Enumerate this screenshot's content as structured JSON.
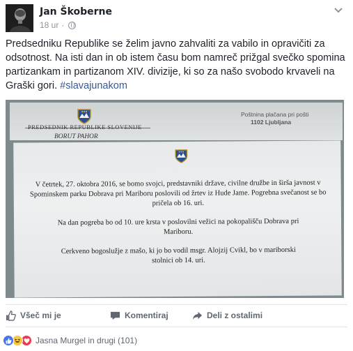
{
  "post": {
    "author": "Jan Škoberne",
    "timestamp": "18 ur",
    "separator": "·",
    "audience_icon": "globe-icon",
    "text_main": "Predsedniku Republike se želim javno zahvaliti za vabilo in opravičiti za odsotnost. Na isti dan in ob istem času bom namreč prižgal svečko spomina partizankam in partizanom XIV. divizije, ki so za našo svobodo krvaveli na Graški gori. ",
    "hashtag": "#slavajunakom"
  },
  "photo": {
    "envelope_title": "PREDSEDNIK REPUBLIKE SLOVENIJE",
    "envelope_name": "BORUT PAHOR",
    "postage_line1": "Poštnina plačana pri pošti",
    "postage_line2": "1102 Ljubljana",
    "card_paragraph1": "V četrtek, 27. oktobra 2016, se bomo svojci, predstavniki države, civilne družbe in širša javnost v Spominskem parku Dobrava pri Mariboru poslovili od žrtev iz Hude Jame. Pogrebna svečanost se bo pričela ob 16. uri.",
    "card_paragraph2": "Na dan pogreba bo od 10. ure krsta v poslovilni vežici na pokopališču Dobrava pri Mariboru.",
    "card_paragraph3": "Cerkveno bogoslužje z mašo, ki jo bo vodil msgr. Alojzij Cvikl, bo v mariborski stolnici ob 14. uri."
  },
  "actions": {
    "like": "Všeč mi je",
    "comment": "Komentiraj",
    "share": "Deli z ostalimi"
  },
  "reactions": {
    "summary": "Jasna Murgel in drugi (101)",
    "colors": {
      "like": "#4a76e8",
      "haha": "#f7c843",
      "love": "#f0394d"
    }
  }
}
